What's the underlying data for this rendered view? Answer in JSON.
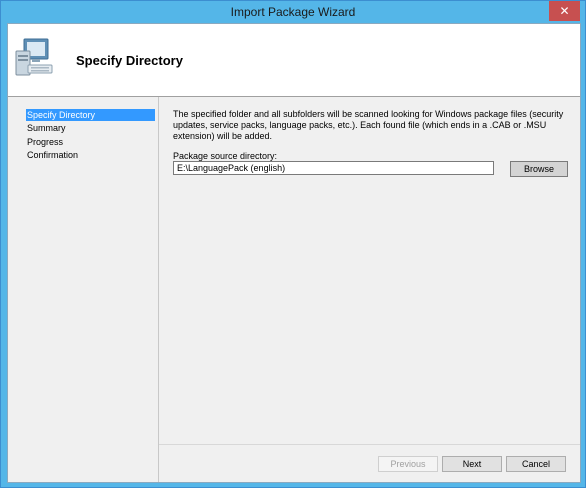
{
  "window": {
    "title": "Import Package Wizard",
    "close_glyph": "✕"
  },
  "header": {
    "title": "Specify Directory",
    "icon": "computer-icon"
  },
  "steps": [
    {
      "label": "Specify Directory",
      "active": true
    },
    {
      "label": "Summary",
      "active": false
    },
    {
      "label": "Progress",
      "active": false
    },
    {
      "label": "Confirmation",
      "active": false
    }
  ],
  "main": {
    "description": "The specified folder and all subfolders will be scanned looking for Windows package files (security updates, service packs, language packs, etc.).  Each found file (which ends in a .CAB or .MSU extension) will be added.",
    "source_label": "Package source directory:",
    "source_value": "E:\\LanguagePack (english)",
    "browse_label": "Browse"
  },
  "footer": {
    "previous_label": "Previous",
    "next_label": "Next",
    "cancel_label": "Cancel"
  },
  "colors": {
    "title_bar": "#54b6e8",
    "active_step": "#3399ff",
    "close_button": "#c75050"
  }
}
